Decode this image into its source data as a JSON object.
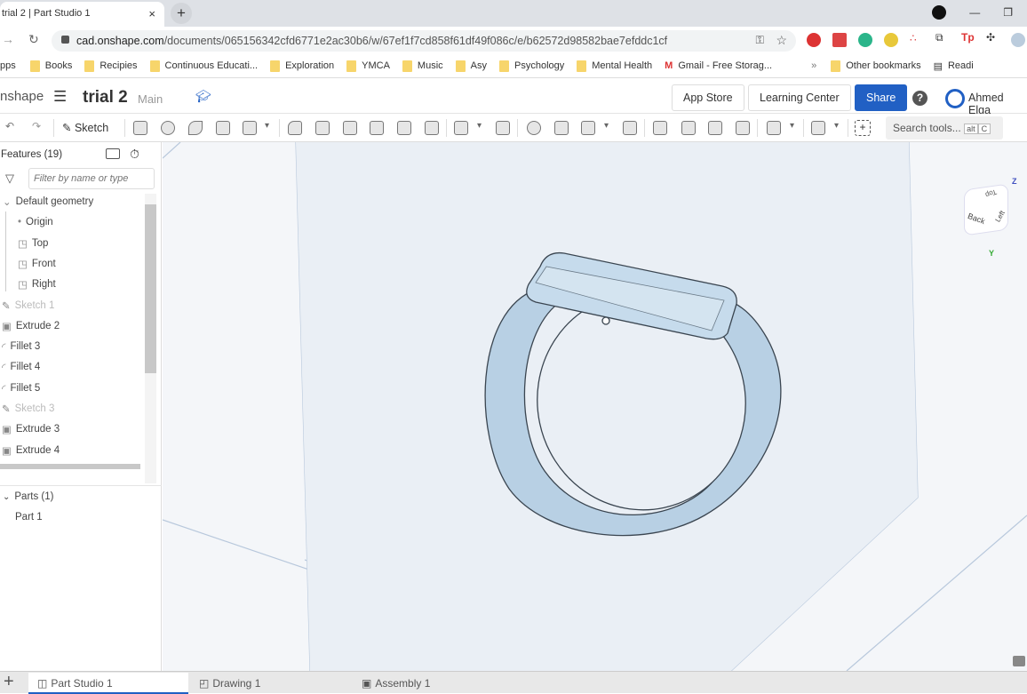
{
  "browser": {
    "tab_title": "trial 2 | Part Studio 1",
    "tab_close": "×",
    "new_tab": "+",
    "url_domain": "cad.onshape.com",
    "url_path": "/documents/065156342cfd6771e2ac30b6/w/67ef1f7cd858f61df49f086c/e/b62572d98582bae7efddc1cf",
    "win_min": "—",
    "win_restore": "❐",
    "bookmarks": [
      "pps",
      "Books",
      "Recipies",
      "Continuous Educati...",
      "Exploration",
      "YMCA",
      "Music",
      "Asy",
      "Psychology",
      "Mental Health",
      "Gmail - Free Storag..."
    ],
    "more_bookmarks": "»",
    "other_bookmarks": "Other bookmarks",
    "reading_list": "Readi"
  },
  "header": {
    "logo": "nshape",
    "doc_title": "trial 2",
    "branch": "Main",
    "app_store": "App Store",
    "learning_center": "Learning Center",
    "share": "Share",
    "help": "?",
    "user": "Ahmed Elga"
  },
  "toolbar": {
    "sketch": "Sketch",
    "search": "Search tools...",
    "shortcut_1": "alt",
    "shortcut_2": "C"
  },
  "features": {
    "title": "Features (19)",
    "filter_placeholder": "Filter by name or type",
    "items": [
      {
        "label": "Default geometry",
        "type": "group"
      },
      {
        "label": "Origin",
        "type": "origin"
      },
      {
        "label": "Top",
        "type": "plane"
      },
      {
        "label": "Front",
        "type": "plane"
      },
      {
        "label": "Right",
        "type": "plane"
      },
      {
        "label": "Sketch 1",
        "type": "sketch"
      },
      {
        "label": "Extrude 2",
        "type": "extrude"
      },
      {
        "label": "Fillet 3",
        "type": "fillet"
      },
      {
        "label": "Fillet 4",
        "type": "fillet"
      },
      {
        "label": "Fillet 5",
        "type": "fillet"
      },
      {
        "label": "Sketch 3",
        "type": "sketch"
      },
      {
        "label": "Extrude 3",
        "type": "extrude"
      },
      {
        "label": "Extrude 4",
        "type": "extrude"
      }
    ],
    "parts_title": "Parts (1)",
    "parts": [
      "Part 1"
    ]
  },
  "viewcube": {
    "top": "Top",
    "back": "Back",
    "left": "Left",
    "z": "Z",
    "y": "Y"
  },
  "bottom_tabs": [
    {
      "label": "Part Studio 1",
      "active": true
    },
    {
      "label": "Drawing 1",
      "active": false
    },
    {
      "label": "Assembly 1",
      "active": false
    }
  ],
  "add_tab": "+",
  "colors": {
    "share": "#2160c4",
    "part": "#c4d9ea",
    "viewport": "#f4f6f9"
  }
}
